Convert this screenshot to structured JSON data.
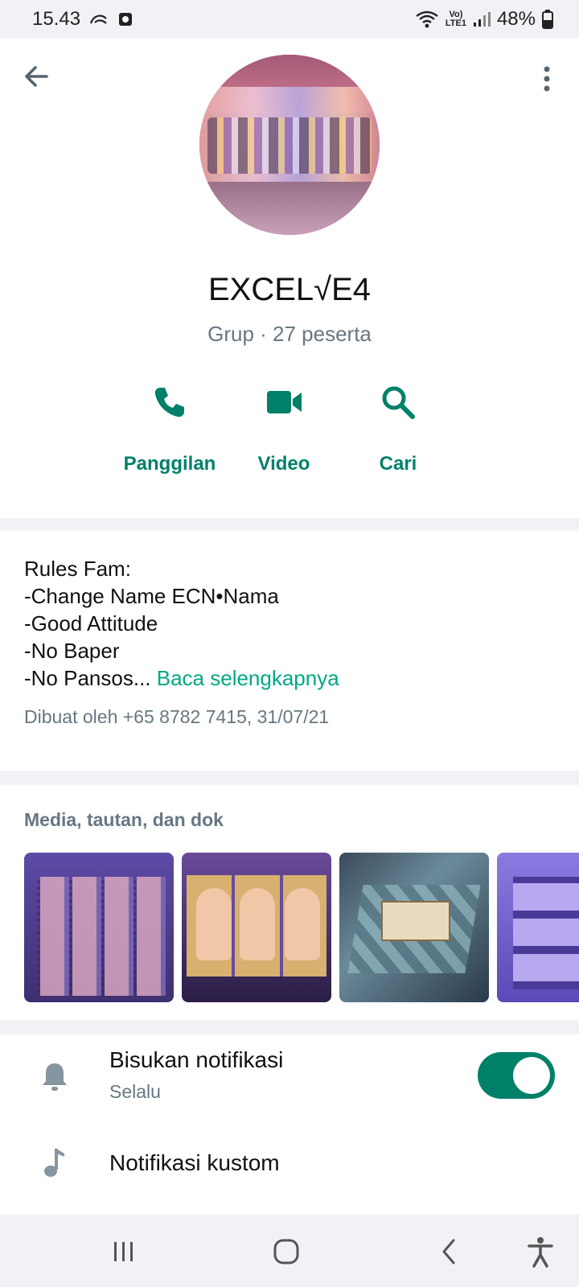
{
  "status_bar": {
    "time": "15.43",
    "network_top": "Vo)",
    "network_bottom": "LTE1",
    "battery_percent": "48%",
    "icons": [
      "alibaba-icon",
      "media-icon",
      "wifi-icon",
      "volte-icon",
      "signal-icon",
      "battery-icon"
    ]
  },
  "header": {
    "back_icon": "arrow-left-icon",
    "more_icon": "more-vert-icon",
    "group_name": "EXCEL√E4",
    "subtitle": "Grup · 27 peserta"
  },
  "actions": [
    {
      "label": "Panggilan",
      "icon": "phone-icon"
    },
    {
      "label": "Video",
      "icon": "video-icon"
    },
    {
      "label": "Cari",
      "icon": "search-icon"
    }
  ],
  "description": {
    "lines": [
      "Rules Fam:",
      "-Change Name ECN•Nama",
      "-Good Attitude",
      "-No Baper"
    ],
    "last_line": "-No Pansos...",
    "read_more": "Baca selengkapnya",
    "created_by": "Dibuat oleh +65 8782 7415, 31/07/21"
  },
  "media": {
    "header": "Media, tautan, dan dok",
    "thumbnails": [
      "character-list-screenshot",
      "character-card-screenshot",
      "game-board-screenshot",
      "event-screenshot"
    ]
  },
  "settings": {
    "mute_title": "Bisukan notifikasi",
    "mute_sub": "Selalu",
    "mute_enabled": true,
    "custom_title": "Notifikasi kustom"
  },
  "colors": {
    "accent": "#008069",
    "link": "#00a884",
    "secondary_text": "#667781"
  },
  "nav": [
    "recents-icon",
    "home-icon",
    "back-icon",
    "accessibility-icon"
  ]
}
